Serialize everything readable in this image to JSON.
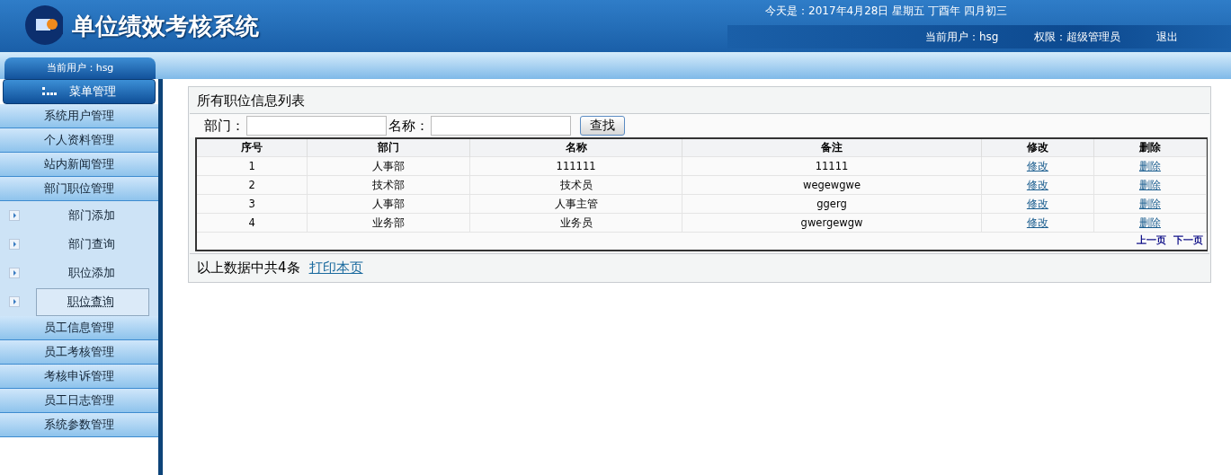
{
  "header": {
    "title": "单位绩效考核系统",
    "date": "今天是：2017年4月28日  星期五  丁酉年  四月初三",
    "user": "当前用户：hsg",
    "role": "权限：超级管理员",
    "logout": "退出"
  },
  "sidebar": {
    "user": "当前用户：hsg",
    "menu_title": "菜单管理",
    "items": [
      {
        "kind": "group",
        "label": "系统用户管理",
        "selected": false
      },
      {
        "kind": "group",
        "label": "个人资料管理",
        "selected": false
      },
      {
        "kind": "group",
        "label": "站内新闻管理",
        "selected": false
      },
      {
        "kind": "group",
        "label": "部门职位管理",
        "selected": false
      },
      {
        "kind": "sub",
        "label": "部门添加",
        "selected": false
      },
      {
        "kind": "sub",
        "label": "部门查询",
        "selected": false
      },
      {
        "kind": "sub",
        "label": "职位添加",
        "selected": false
      },
      {
        "kind": "sub",
        "label": "职位查询",
        "selected": true
      },
      {
        "kind": "group",
        "label": "员工信息管理",
        "selected": false
      },
      {
        "kind": "group",
        "label": "员工考核管理",
        "selected": false
      },
      {
        "kind": "group",
        "label": "考核申诉管理",
        "selected": false
      },
      {
        "kind": "group",
        "label": "员工日志管理",
        "selected": false
      },
      {
        "kind": "group",
        "label": "系统参数管理",
        "selected": false
      }
    ]
  },
  "panel": {
    "title": "所有职位信息列表",
    "search": [
      {
        "label": "部门："
      },
      {
        "label": "名称："
      }
    ],
    "search_button": "查找",
    "columns": [
      "序号",
      "部门",
      "名称",
      "备注",
      "修改",
      "删除"
    ],
    "rows": [
      {
        "no": "1",
        "dept": "人事部",
        "name": "111111",
        "note": "11111",
        "edit": "修改",
        "delete": "删除"
      },
      {
        "no": "2",
        "dept": "技术部",
        "name": "技术员",
        "note": "wegewgwe",
        "edit": "修改",
        "delete": "删除"
      },
      {
        "no": "3",
        "dept": "人事部",
        "name": "人事主管",
        "note": "ggerg",
        "edit": "修改",
        "delete": "删除"
      },
      {
        "no": "4",
        "dept": "业务部",
        "name": "业务员",
        "note": "gwergewgw",
        "edit": "修改",
        "delete": "删除"
      }
    ],
    "pager": [
      "上一页",
      "下一页"
    ],
    "summary": "以上数据中共4条",
    "print": "打印本页"
  }
}
